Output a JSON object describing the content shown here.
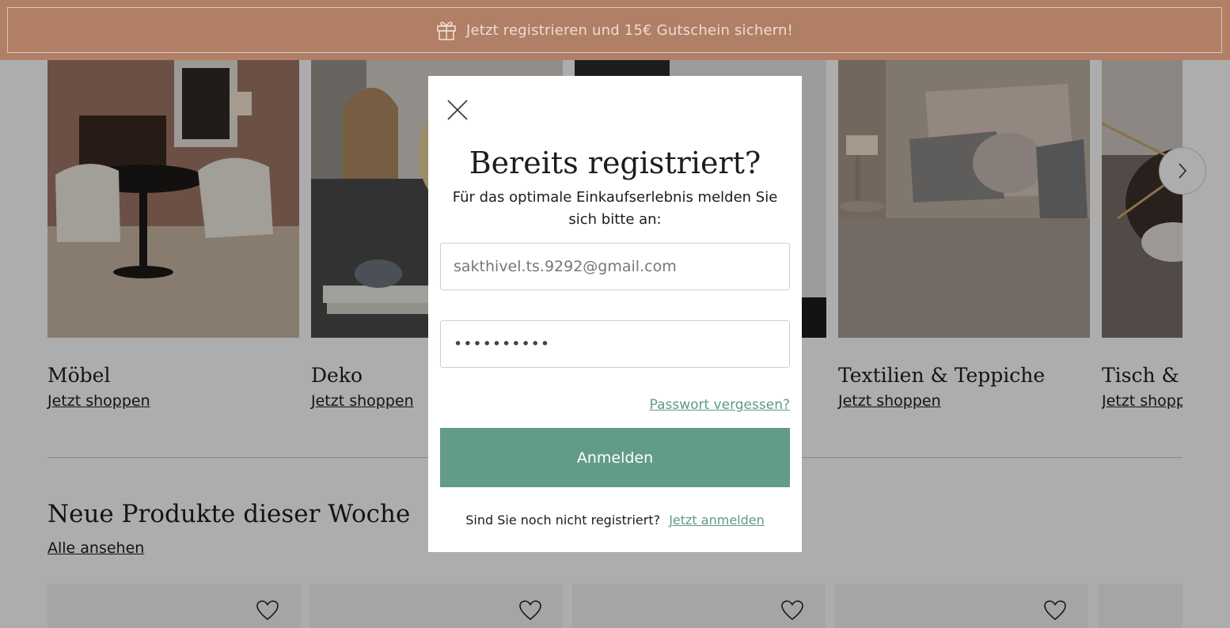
{
  "promo": {
    "text": "Jetzt registrieren und 15€ Gutschein sichern!",
    "icon": "gift-icon"
  },
  "categories": [
    {
      "title": "Möbel",
      "link": "Jetzt shoppen"
    },
    {
      "title": "Deko",
      "link": "Jetzt shoppen"
    },
    {
      "title": "",
      "link": ""
    },
    {
      "title": "Textilien & Teppiche",
      "link": "Jetzt shoppen"
    },
    {
      "title": "Tisch & K",
      "link": "Jetzt shopp"
    }
  ],
  "section": {
    "title": "Neue Produkte dieser Woche",
    "link": "Alle ansehen"
  },
  "modal": {
    "title": "Bereits registriert?",
    "subtitle": "Für das optimale Einkaufserlebnis melden Sie sich bitte an:",
    "email_value": "sakthivel.ts.9292@gmail.com",
    "password_value": "••••••••••",
    "forgot_label": "Passwort vergessen?",
    "login_label": "Anmelden",
    "register_prompt": "Sind Sie noch nicht registriert?",
    "register_link": "Jetzt anmelden"
  },
  "colors": {
    "promo_bg": "#b07f66",
    "accent": "#629b8a",
    "link_accent": "#5e9a89"
  }
}
